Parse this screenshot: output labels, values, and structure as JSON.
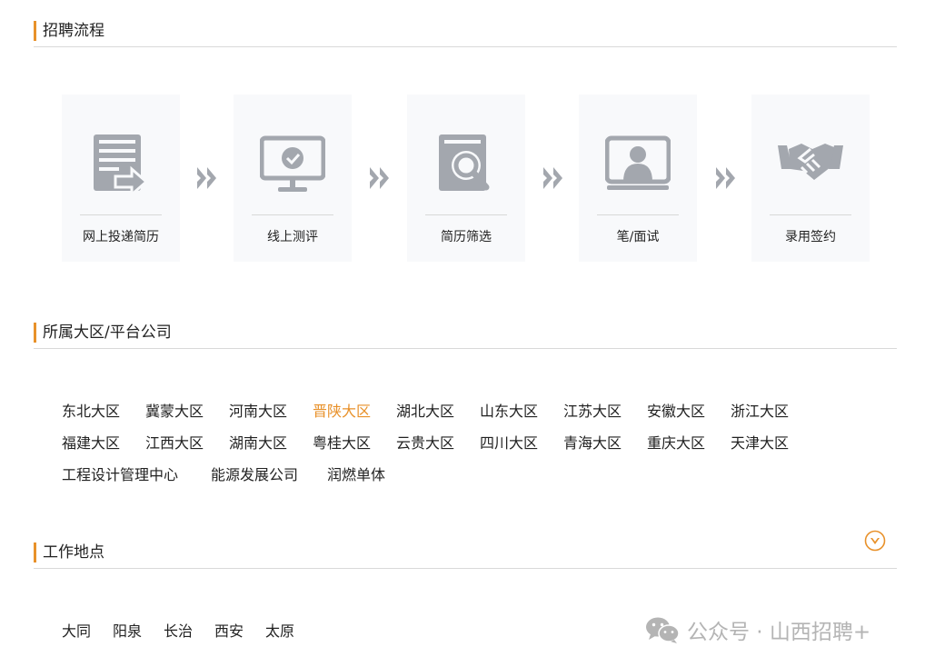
{
  "sections": {
    "process": {
      "title": "招聘流程"
    },
    "region": {
      "title": "所属大区/平台公司"
    },
    "location": {
      "title": "工作地点"
    }
  },
  "process_steps": [
    {
      "label": "网上投递简历",
      "icon": "resume-submit-icon"
    },
    {
      "label": "线上测评",
      "icon": "online-test-icon"
    },
    {
      "label": "简历筛选",
      "icon": "resume-screen-icon"
    },
    {
      "label": "笔/面试",
      "icon": "interview-icon"
    },
    {
      "label": "录用签约",
      "icon": "handshake-icon"
    }
  ],
  "regions": [
    "东北大区",
    "冀蒙大区",
    "河南大区",
    "晋陕大区",
    "湖北大区",
    "山东大区",
    "江苏大区",
    "安徽大区",
    "浙江大区",
    "福建大区",
    "江西大区",
    "湖南大区",
    "粤桂大区",
    "云贵大区",
    "四川大区",
    "青海大区",
    "重庆大区",
    "天津大区",
    "工程设计管理中心",
    "能源发展公司",
    "润燃单体"
  ],
  "selected_region": "晋陕大区",
  "locations": [
    "大同",
    "阳泉",
    "长治",
    "西安",
    "太原"
  ],
  "watermark": {
    "text": "公众号 · 山西招聘+"
  },
  "colors": {
    "accent": "#e8912a",
    "icon_gray": "#a3a7ae"
  }
}
